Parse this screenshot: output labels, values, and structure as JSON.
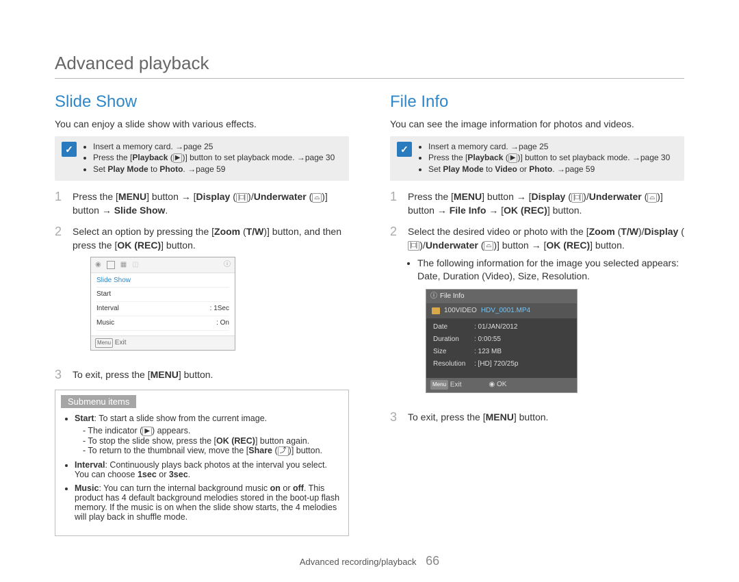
{
  "page_title": "Advanced playback",
  "footer": {
    "text": "Advanced recording/playback",
    "page": "66"
  },
  "left": {
    "heading": "Slide Show",
    "intro": "You can enjoy a slide show with various effects.",
    "notes": {
      "n0": "Insert a memory card. →page 25",
      "n1_a": "Press the [",
      "n1_b": "Playback",
      "n1_c": " (",
      "n1_d": ")] button to set playback mode. →page 30",
      "n2_a": "Set ",
      "n2_b": "Play Mode",
      "n2_c": " to ",
      "n2_d": "Photo",
      "n2_e": ". →page 59"
    },
    "step1": {
      "a": "Press the [",
      "b": "MENU",
      "c": "] button → [",
      "d": "Display",
      "e": " (",
      "f": ")/",
      "g": "Underwater",
      "h": " (",
      "i": ")]",
      "j": " button → ",
      "k": "Slide Show",
      "l": "."
    },
    "step2": {
      "a": "Select an option by pressing the [",
      "b": "Zoom",
      "c": " (",
      "d": "T/W",
      "e": ")] button, and then press the [",
      "f": "OK (REC)",
      "g": "] button."
    },
    "step3": {
      "a": "To exit, press the [",
      "b": "MENU",
      "c": "] button."
    },
    "screen": {
      "title": "Slide Show",
      "rows": {
        "r0": {
          "label": "Start",
          "value": ""
        },
        "r1": {
          "label": "Interval",
          "value": ": 1Sec"
        },
        "r2": {
          "label": "Music",
          "value": ": On"
        }
      },
      "exit_label": "Exit",
      "menu_badge": "Menu"
    },
    "submenu": {
      "tag": "Submenu items",
      "start": {
        "label": "Start",
        "desc": ": To start a slide show from the current image.",
        "s1a": "- The indicator (",
        "s1b": ") appears.",
        "s2a": "- To stop the slide show, press the [",
        "s2b": "OK (REC)",
        "s2c": "] button again.",
        "s3a": "- To return to the thumbnail view, move the [",
        "s3b": "Share",
        "s3c": " (",
        "s3d": ")] button."
      },
      "interval": {
        "label": "Interval",
        "desc_a": ": Continuously plays back photos at the interval you select. You can choose ",
        "desc_b": "1sec",
        "desc_c": " or ",
        "desc_d": "3sec",
        "desc_e": "."
      },
      "music": {
        "label": "Music",
        "desc_a": ": You can turn the internal background music ",
        "desc_b": "on",
        "desc_c": " or ",
        "desc_d": "off",
        "desc_e": ". This product has 4 default background melodies stored in the boot-up flash memory. If the music is on when the slide show starts, the 4 melodies will play back in shuffle mode."
      }
    }
  },
  "right": {
    "heading": "File Info",
    "intro": "You can see the image information for photos and videos.",
    "notes": {
      "n0": "Insert a memory card. →page 25",
      "n1_a": "Press the [",
      "n1_b": "Playback",
      "n1_c": " (",
      "n1_d": ")] button to set playback mode. →page 30",
      "n2_a": "Set ",
      "n2_b": "Play Mode",
      "n2_c": " to ",
      "n2_d": "Video",
      "n2_e": " or ",
      "n2_f": "Photo",
      "n2_g": ". →page 59"
    },
    "step1": {
      "a": "Press the [",
      "b": "MENU",
      "c": "] button → [",
      "d": "Display",
      "e": " (",
      "f": ")/",
      "g": "Underwater",
      "h": " (",
      "i": ")]",
      "j": " button → ",
      "k": "File Info",
      "l": " → [",
      "m": "OK (REC)",
      "n": "] button."
    },
    "step2": {
      "a": "Select the desired video or photo with the [",
      "b": "Zoom",
      "c": " (",
      "d": "T/W",
      "e": ")/",
      "f": "Display",
      "g": " (",
      "h": ")/",
      "i": "Underwater",
      "j": " (",
      "k": ")] button → [",
      "l": "OK (REC)",
      "m": "] button.",
      "bullet": "The following information for the image you selected appears: Date, Duration (Video), Size, Resolution."
    },
    "step3": {
      "a": "To exit, press the [",
      "b": "MENU",
      "c": "] button."
    },
    "screen": {
      "header": "File Info",
      "folder": "100VIDEO",
      "filename": "HDV_0001.MP4",
      "rows": {
        "date": {
          "label": "Date",
          "value": ": 01/JAN/2012"
        },
        "duration": {
          "label": "Duration",
          "value": ": 0:00:55"
        },
        "size": {
          "label": "Size",
          "value": ": 123 MB"
        },
        "resolution": {
          "label": "Resolution",
          "value": ": [HD] 720/25p"
        }
      },
      "exit_label": "Exit",
      "ok_label": "OK",
      "menu_badge": "Menu"
    }
  },
  "chart_data": {
    "type": "table",
    "title": "File Info",
    "rows": [
      {
        "label": "Date",
        "value": "01/JAN/2012"
      },
      {
        "label": "Duration",
        "value": "0:00:55"
      },
      {
        "label": "Size",
        "value": "123 MB"
      },
      {
        "label": "Resolution",
        "value": "[HD] 720/25p"
      }
    ]
  }
}
